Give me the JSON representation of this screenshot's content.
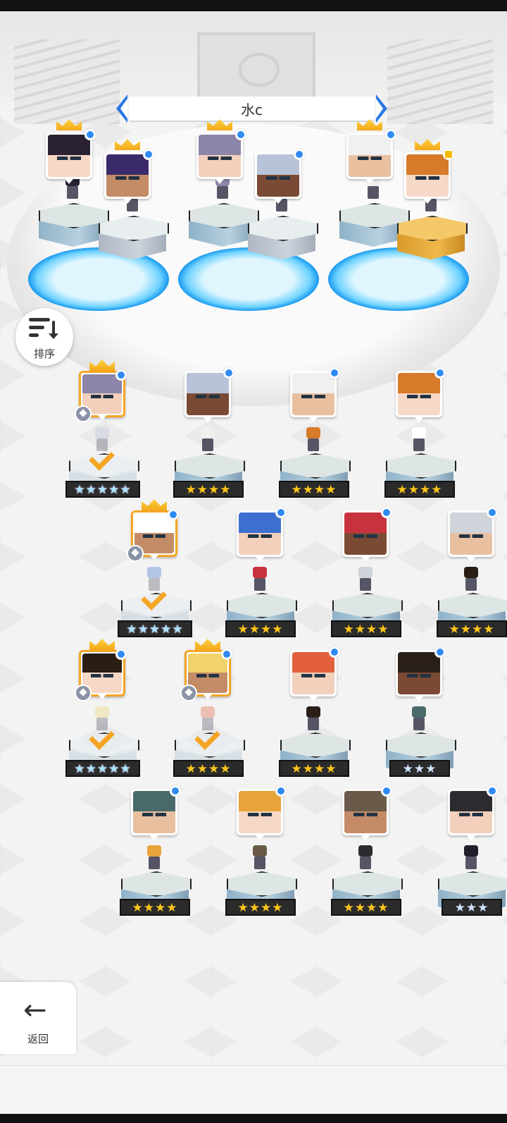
{
  "header": {
    "title": "水c"
  },
  "sort_button": {
    "label": "排序",
    "icon": "sort-descending-icon"
  },
  "back_button": {
    "label": "返回",
    "icon": "arrow-left-icon"
  },
  "colors": {
    "accent_blue": "#2f8bf2",
    "gold": "#f5a524",
    "star_yellow": "#ffc61a"
  },
  "team": [
    {
      "crowned": true,
      "badge": "blue-dot",
      "pedestal": "stone"
    },
    {
      "crowned": true,
      "badge": "blue-dot",
      "pedestal": "gray"
    },
    {
      "crowned": true,
      "badge": "blue-dot",
      "pedestal": "stone"
    },
    {
      "crowned": false,
      "badge": "blue-dot",
      "pedestal": "gray"
    },
    {
      "crowned": true,
      "badge": "blue-dot",
      "pedestal": "stone"
    },
    {
      "crowned": true,
      "badge": "lightning",
      "pedestal": "gold"
    }
  ],
  "roster": [
    {
      "stars": "★★★★★",
      "rarity": 5,
      "crowned": true,
      "selected": true,
      "badge": "blue-dot"
    },
    {
      "stars": "★★★★",
      "rarity": 4,
      "crowned": false,
      "selected": false,
      "badge": "blue-dot"
    },
    {
      "stars": "★★★★",
      "rarity": 4,
      "crowned": false,
      "selected": false,
      "badge": "blue-dot"
    },
    {
      "stars": "★★★★",
      "rarity": 4,
      "crowned": false,
      "selected": false,
      "badge": "blue-dot"
    },
    {
      "stars": "★★★★★",
      "rarity": 5,
      "crowned": true,
      "selected": true,
      "badge": "blue-dot"
    },
    {
      "stars": "★★★★",
      "rarity": 4,
      "crowned": false,
      "selected": false,
      "badge": "blue-dot"
    },
    {
      "stars": "★★★★",
      "rarity": 4,
      "crowned": false,
      "selected": false,
      "badge": "blue-dot"
    },
    {
      "stars": "★★★★",
      "rarity": 4,
      "crowned": false,
      "selected": false,
      "badge": "blue-dot"
    },
    {
      "stars": "★★★★★",
      "rarity": 5,
      "crowned": true,
      "selected": true,
      "badge": "blue-dot"
    },
    {
      "stars": "★★★★",
      "rarity": 4,
      "crowned": true,
      "selected": true,
      "badge": "blue-dot"
    },
    {
      "stars": "★★★★",
      "rarity": 4,
      "crowned": false,
      "selected": false,
      "badge": "blue-dot"
    },
    {
      "stars": "★★★",
      "rarity": 3,
      "crowned": false,
      "selected": false,
      "badge": "blue-dot"
    },
    {
      "stars": "★★★★",
      "rarity": 4,
      "crowned": false,
      "selected": false,
      "badge": "blue-dot"
    },
    {
      "stars": "★★★★",
      "rarity": 4,
      "crowned": false,
      "selected": false,
      "badge": "blue-dot"
    },
    {
      "stars": "★★★★",
      "rarity": 4,
      "crowned": false,
      "selected": false,
      "badge": "blue-dot"
    },
    {
      "stars": "★★★",
      "rarity": 3,
      "crowned": false,
      "selected": false,
      "badge": "blue-dot"
    }
  ]
}
